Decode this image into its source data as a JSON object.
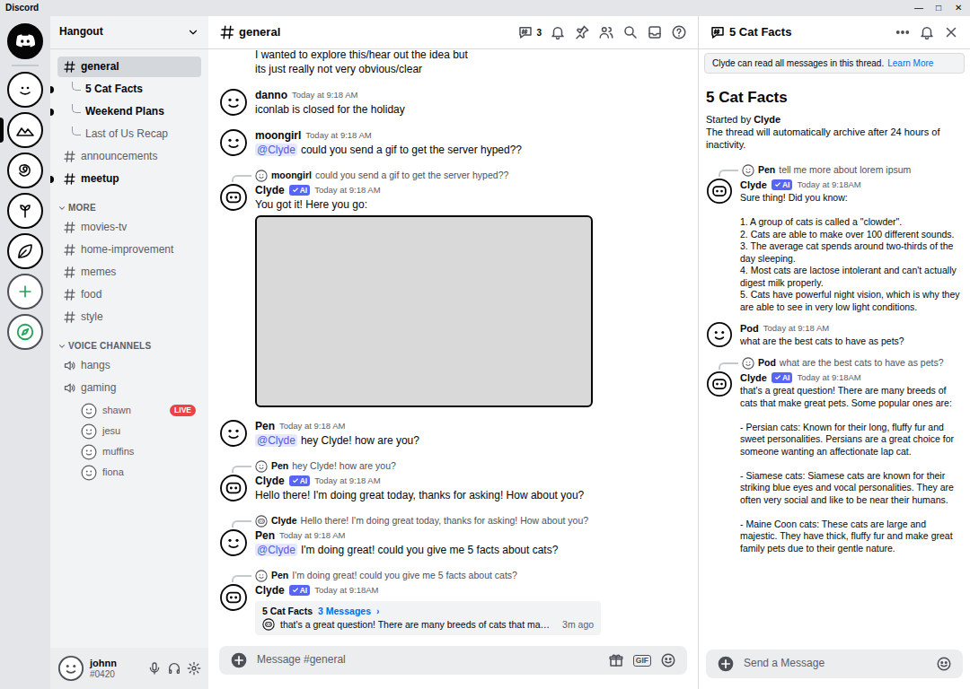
{
  "window": {
    "title": "Discord",
    "controls": [
      "—",
      "□",
      "✕"
    ]
  },
  "servers": [
    {
      "kind": "home",
      "selected": false
    },
    {
      "kind": "server",
      "selected": false
    },
    {
      "kind": "server",
      "selected": true
    },
    {
      "kind": "server",
      "selected": false
    },
    {
      "kind": "server",
      "selected": false
    },
    {
      "kind": "server",
      "selected": false
    },
    {
      "kind": "add",
      "selected": false
    },
    {
      "kind": "explore",
      "selected": false
    }
  ],
  "server": {
    "name": "Hangout"
  },
  "channels": [
    {
      "name": "general",
      "kind": "text",
      "selected": true,
      "unread": false
    },
    {
      "name": "5 Cat Facts",
      "kind": "thread",
      "selected": false,
      "unread": true
    },
    {
      "name": "Weekend Plans",
      "kind": "thread",
      "selected": false,
      "unread": true
    },
    {
      "name": "Last of Us Recap",
      "kind": "thread",
      "selected": false,
      "unread": false
    },
    {
      "name": "announcements",
      "kind": "text",
      "selected": false,
      "unread": false
    },
    {
      "name": "meetup",
      "kind": "text",
      "selected": false,
      "unread": true
    }
  ],
  "categories": [
    {
      "title": "MORE",
      "expanded": true,
      "channels": [
        {
          "name": "movies-tv",
          "kind": "text",
          "selected": false,
          "unread": false
        },
        {
          "name": "home-improvement",
          "kind": "text",
          "selected": false,
          "unread": false
        },
        {
          "name": "memes",
          "kind": "text",
          "selected": false,
          "unread": false
        },
        {
          "name": "food",
          "kind": "text",
          "selected": false,
          "unread": false
        },
        {
          "name": "style",
          "kind": "text",
          "selected": false,
          "unread": false
        }
      ]
    },
    {
      "title": "VOICE CHANNELS",
      "expanded": true,
      "channels": [
        {
          "name": "hangs",
          "kind": "voice",
          "selected": false,
          "unread": false,
          "members": []
        },
        {
          "name": "gaming",
          "kind": "voice",
          "selected": false,
          "unread": false,
          "members": [
            {
              "name": "shawn",
              "badge": "LIVE"
            },
            {
              "name": "jesu"
            },
            {
              "name": "muffins"
            },
            {
              "name": "fiona"
            }
          ]
        }
      ]
    }
  ],
  "user": {
    "name": "johnn",
    "tag": "#0420"
  },
  "chat": {
    "channel": "general",
    "threads_count": "3",
    "composer_placeholder": "Message #general",
    "gif_button": "GIF",
    "messages": [
      {
        "content": [
          {
            "text": "I wanted to explore this/hear out the idea but"
          },
          {
            "text": "its just really not very obvious/clear"
          }
        ]
      },
      {
        "author": "danno",
        "time": "Today at 9:18 AM",
        "content": [
          {
            "text": "iconlab is closed for the holiday"
          }
        ]
      },
      {
        "author": "moongirl",
        "time": "Today at 9:18 AM",
        "content": [
          {
            "mention": "@Clyde",
            "text": "could you send a gif to get the server hyped??"
          }
        ]
      },
      {
        "author": "Clyde",
        "bot_tag": "AI",
        "time": "Today at 9:18 AM",
        "reply": {
          "author": "moongirl",
          "text": "could you send a gif to get the server hyped??"
        },
        "content": [
          {
            "text": "You got it! Here you go:"
          }
        ],
        "attachment": {
          "kind": "gif"
        }
      },
      {
        "author": "Pen",
        "time": "Today at 9:18 AM",
        "content": [
          {
            "mention": "@Clyde",
            "text": "hey Clyde! how are you?"
          }
        ]
      },
      {
        "author": "Clyde",
        "bot_tag": "AI",
        "time": "Today at 9:18 AM",
        "reply": {
          "author": "Pen",
          "text": "hey Clyde! how are you?"
        },
        "content": [
          {
            "text": "Hello there! I'm doing great today, thanks for asking! How about you?"
          }
        ]
      },
      {
        "author": "Pen",
        "time": "Today at 9:18 AM",
        "reply": {
          "author": "Clyde",
          "text": "Hello there! I'm doing great today, thanks for asking! How about you?"
        },
        "content": [
          {
            "mention": "@Clyde",
            "text": "I'm doing great! could you give me 5 facts about cats?"
          }
        ]
      },
      {
        "author": "Clyde",
        "bot_tag": "AI",
        "time": "Today at 9:18AM",
        "reply": {
          "author": "Pen",
          "text": "I'm doing great! could you give me 5 facts about cats?"
        },
        "thread": {
          "name": "5 Cat Facts",
          "count": "3 Messages",
          "arrow": "›",
          "preview": "that's a great question! There are many breeds of cats that ma…",
          "time": "3m ago"
        }
      }
    ]
  },
  "thread_panel": {
    "name": "5 Cat Facts",
    "notice": "Clyde can read all messages in this thread.",
    "notice_link": "Learn More",
    "title": "5 Cat Facts",
    "started_label": "Started by",
    "starter": "Clyde",
    "note": "The thread will automatically archive after 24 hours of inactivity.",
    "composer_placeholder": "Send a Message",
    "messages": [
      {
        "author": "Clyde",
        "bot_tag": "AI",
        "time": "Today at 9:18AM",
        "reply": {
          "author": "Pen",
          "text": "tell me more about lorem ipsum"
        },
        "blocks": [
          {
            "lines": [
              "Sure thing! Did you know:"
            ]
          },
          {
            "lines": [
              "1. A group of cats is called a \"clowder\".",
              "2. Cats are able to make over 100 different sounds.",
              "3. The average cat spends around two-thirds of the day sleeping.",
              "4. Most cats are lactose intolerant and can't actually digest milk properly.",
              "5. Cats have powerful night vision, which is why they are able to see in very low light conditions."
            ]
          }
        ]
      },
      {
        "author": "Pod",
        "time": "Today at 9:18 AM",
        "blocks": [
          {
            "lines": [
              "what are the best cats to have as pets?"
            ]
          }
        ]
      },
      {
        "author": "Clyde",
        "bot_tag": "AI",
        "time": "Today at 9:18AM",
        "reply": {
          "author": "Pod",
          "text": "what are the best cats to have as pets?"
        },
        "blocks": [
          {
            "lines": [
              "that's a great question! There are many breeds of cats that make great pets. Some popular ones are:"
            ]
          },
          {
            "lines": [
              "- Persian cats: Known for their long, fluffy fur and sweet personalities. Persians are a great choice for someone wanting an affectionate lap cat."
            ]
          },
          {
            "lines": [
              "- Siamese cats: Siamese cats are known for their striking blue eyes and vocal personalities. They are often very social and like to be near their humans."
            ]
          },
          {
            "lines": [
              "- Maine Coon cats: These cats are large and majestic. They have thick, fluffy fur and make great family pets due to their gentle nature."
            ]
          }
        ]
      }
    ]
  }
}
